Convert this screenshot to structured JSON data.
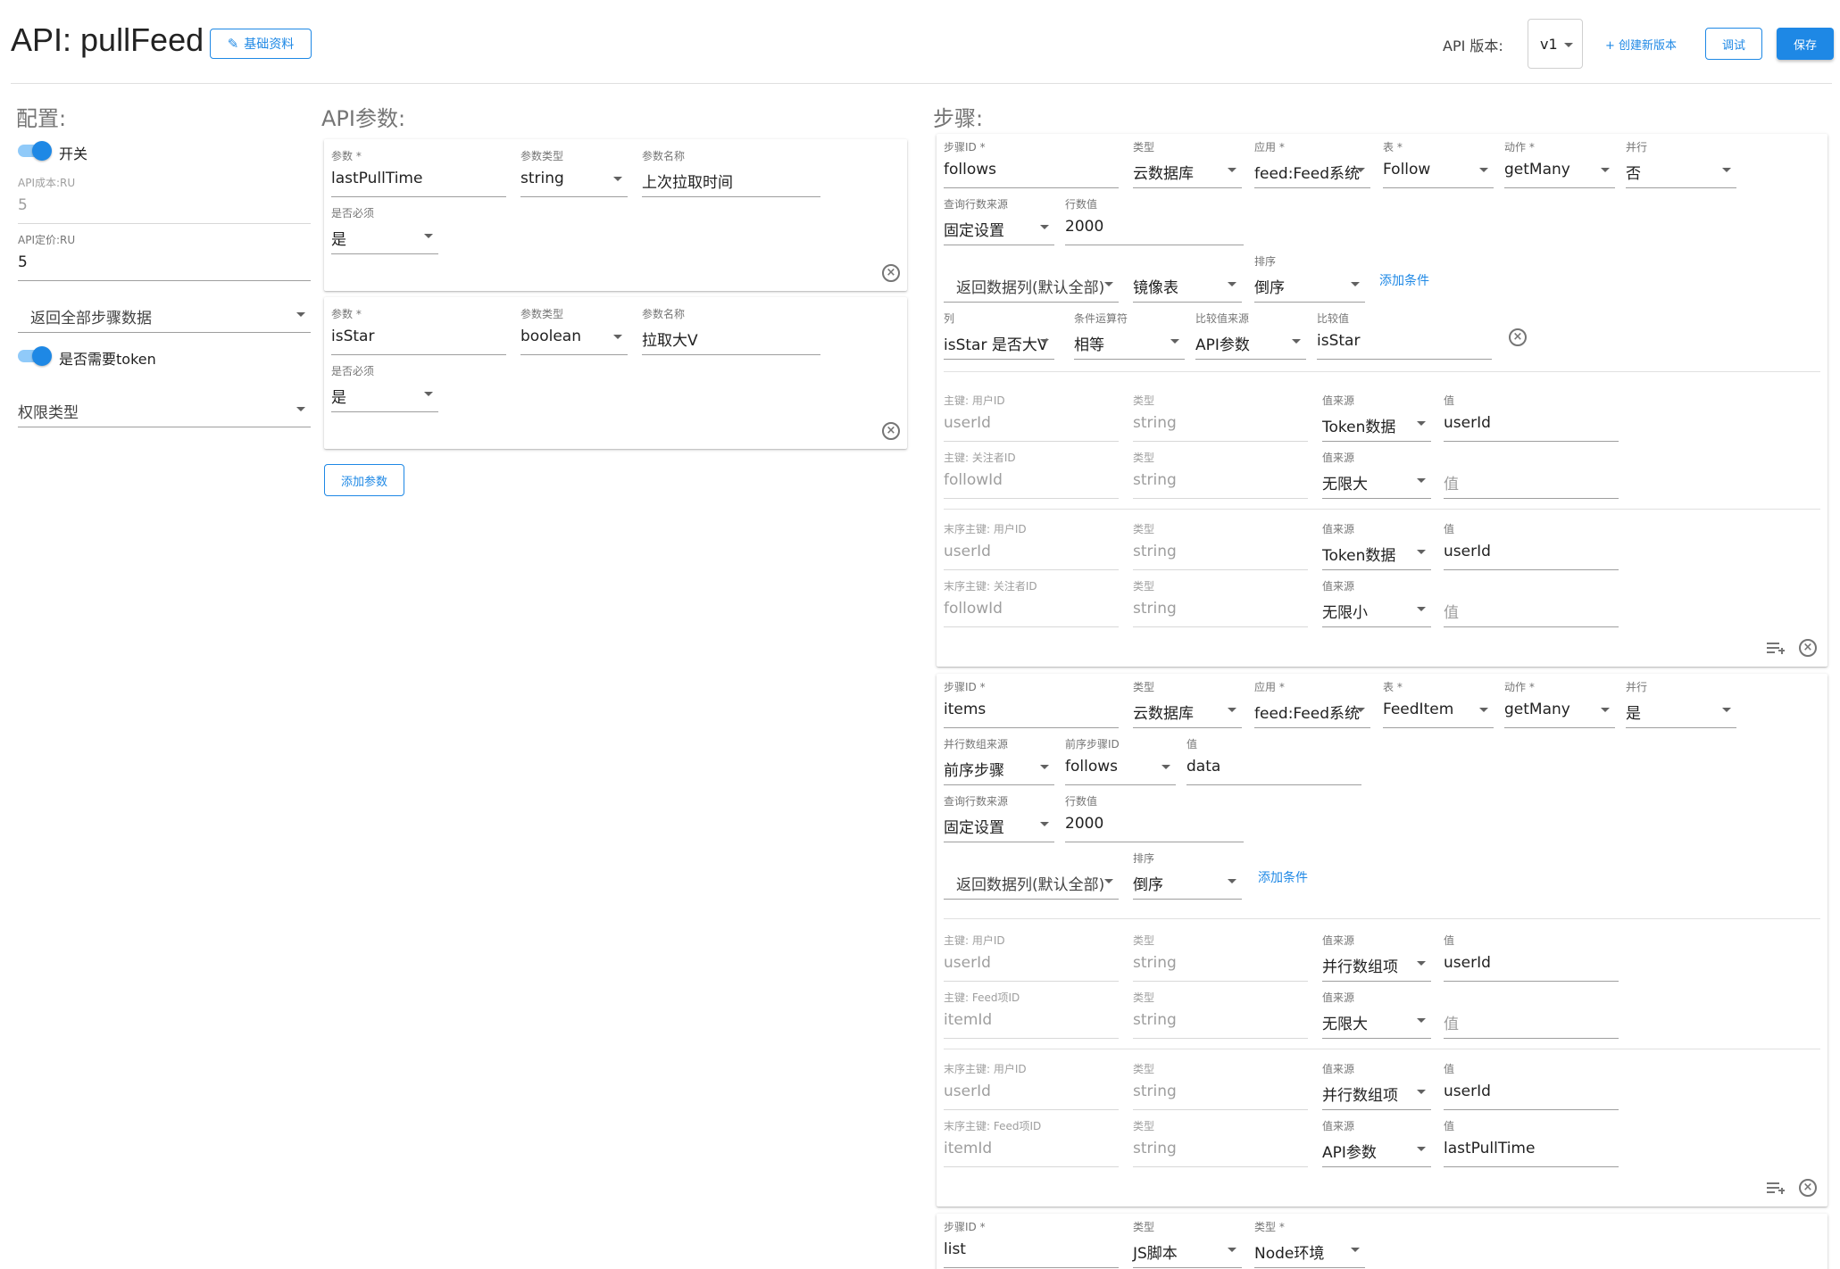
{
  "header": {
    "title": "API: pullFeed",
    "basic_info": "基础资料",
    "version_label": "API 版本:",
    "version_value": "v1",
    "create_version": "+ 创建新版本",
    "debug": "调试",
    "save": "保存"
  },
  "config": {
    "title": "配置:",
    "switch_label": "开关",
    "cost_label": "API成本:RU",
    "cost_value": "5",
    "price_label": "API定价:RU",
    "price_value": "5",
    "return_select": "返回全部步骤数据",
    "token_label": "是否需要token",
    "permission_placeholder": "权限类型"
  },
  "params": {
    "title": "API参数:",
    "add_button": "添加参数",
    "items": [
      {
        "param_label": "参数 *",
        "param_value": "lastPullTime",
        "type_label": "参数类型",
        "type_value": "string",
        "name_label": "参数名称",
        "name_value": "上次拉取时间",
        "required_label": "是否必须",
        "required_value": "是"
      },
      {
        "param_label": "参数 *",
        "param_value": "isStar",
        "type_label": "参数类型",
        "type_value": "boolean",
        "name_label": "参数名称",
        "name_value": "拉取大V",
        "required_label": "是否必须",
        "required_value": "是"
      }
    ]
  },
  "steps": {
    "title": "步骤:",
    "step1": {
      "id_label": "步骤ID *",
      "id_value": "follows",
      "type_label": "类型",
      "type_value": "云数据库",
      "app_label": "应用 *",
      "app_value": "feed:Feed系统",
      "table_label": "表 *",
      "table_value": "Follow",
      "action_label": "动作 *",
      "action_value": "getMany",
      "parallel_label": "并行",
      "parallel_value": "否",
      "rows_src_label": "查询行数来源",
      "rows_src_value": "固定设置",
      "rows_label": "行数值",
      "rows_value": "2000",
      "return_cols": "返回数据列(默认全部)",
      "mirror": "镜像表",
      "sort_label": "排序",
      "sort_value": "倒序",
      "add_cond": "添加条件",
      "cond": {
        "col_label": "列",
        "col_value": "isStar 是否大V",
        "op_label": "条件运算符",
        "op_value": "相等",
        "cmp_src_label": "比较值来源",
        "cmp_src_value": "API参数",
        "cmp_label": "比较值",
        "cmp_value": "isStar"
      },
      "keys": [
        {
          "k_label": "主键: 用户ID",
          "k_value": "userId",
          "t_label": "类型",
          "t_value": "string",
          "s_label": "值来源",
          "s_value": "Token数据",
          "v_label": "值",
          "v_value": "userId"
        },
        {
          "k_label": "主键: 关注者ID",
          "k_value": "followId",
          "t_label": "类型",
          "t_value": "string",
          "s_label": "值来源",
          "s_value": "无限大",
          "v_label": "",
          "v_value": "值"
        },
        {
          "k_label": "末序主键: 用户ID",
          "k_value": "userId",
          "t_label": "类型",
          "t_value": "string",
          "s_label": "值来源",
          "s_value": "Token数据",
          "v_label": "值",
          "v_value": "userId"
        },
        {
          "k_label": "末序主键: 关注者ID",
          "k_value": "followId",
          "t_label": "类型",
          "t_value": "string",
          "s_label": "值来源",
          "s_value": "无限小",
          "v_label": "",
          "v_value": "值"
        }
      ]
    },
    "step2": {
      "id_label": "步骤ID *",
      "id_value": "items",
      "type_label": "类型",
      "type_value": "云数据库",
      "app_label": "应用 *",
      "app_value": "feed:Feed系统",
      "table_label": "表 *",
      "table_value": "FeedItem",
      "action_label": "动作 *",
      "action_value": "getMany",
      "parallel_label": "并行",
      "parallel_value": "是",
      "par_src_label": "并行数组来源",
      "par_src_value": "前序步骤",
      "prev_label": "前序步骤ID",
      "prev_value": "follows",
      "val_label": "值",
      "val_value": "data",
      "rows_src_label": "查询行数来源",
      "rows_src_value": "固定设置",
      "rows_label": "行数值",
      "rows_value": "2000",
      "return_cols": "返回数据列(默认全部)",
      "sort_label": "排序",
      "sort_value": "倒序",
      "add_cond": "添加条件",
      "keys": [
        {
          "k_label": "主键: 用户ID",
          "k_value": "userId",
          "t_label": "类型",
          "t_value": "string",
          "s_label": "值来源",
          "s_value": "并行数组项",
          "v_label": "值",
          "v_value": "userId"
        },
        {
          "k_label": "主键: Feed项ID",
          "k_value": "itemId",
          "t_label": "类型",
          "t_value": "string",
          "s_label": "值来源",
          "s_value": "无限大",
          "v_label": "",
          "v_value": "值"
        },
        {
          "k_label": "末序主键: 用户ID",
          "k_value": "userId",
          "t_label": "类型",
          "t_value": "string",
          "s_label": "值来源",
          "s_value": "并行数组项",
          "v_label": "值",
          "v_value": "userId"
        },
        {
          "k_label": "末序主键: Feed项ID",
          "k_value": "itemId",
          "t_label": "类型",
          "t_value": "string",
          "s_label": "值来源",
          "s_value": "API参数",
          "v_label": "值",
          "v_value": "lastPullTime"
        }
      ]
    },
    "step3": {
      "id_label": "步骤ID *",
      "id_value": "list",
      "type_label": "类型",
      "type_value": "JS脚本",
      "env_label": "类型 *",
      "env_value": "Node环境"
    }
  }
}
